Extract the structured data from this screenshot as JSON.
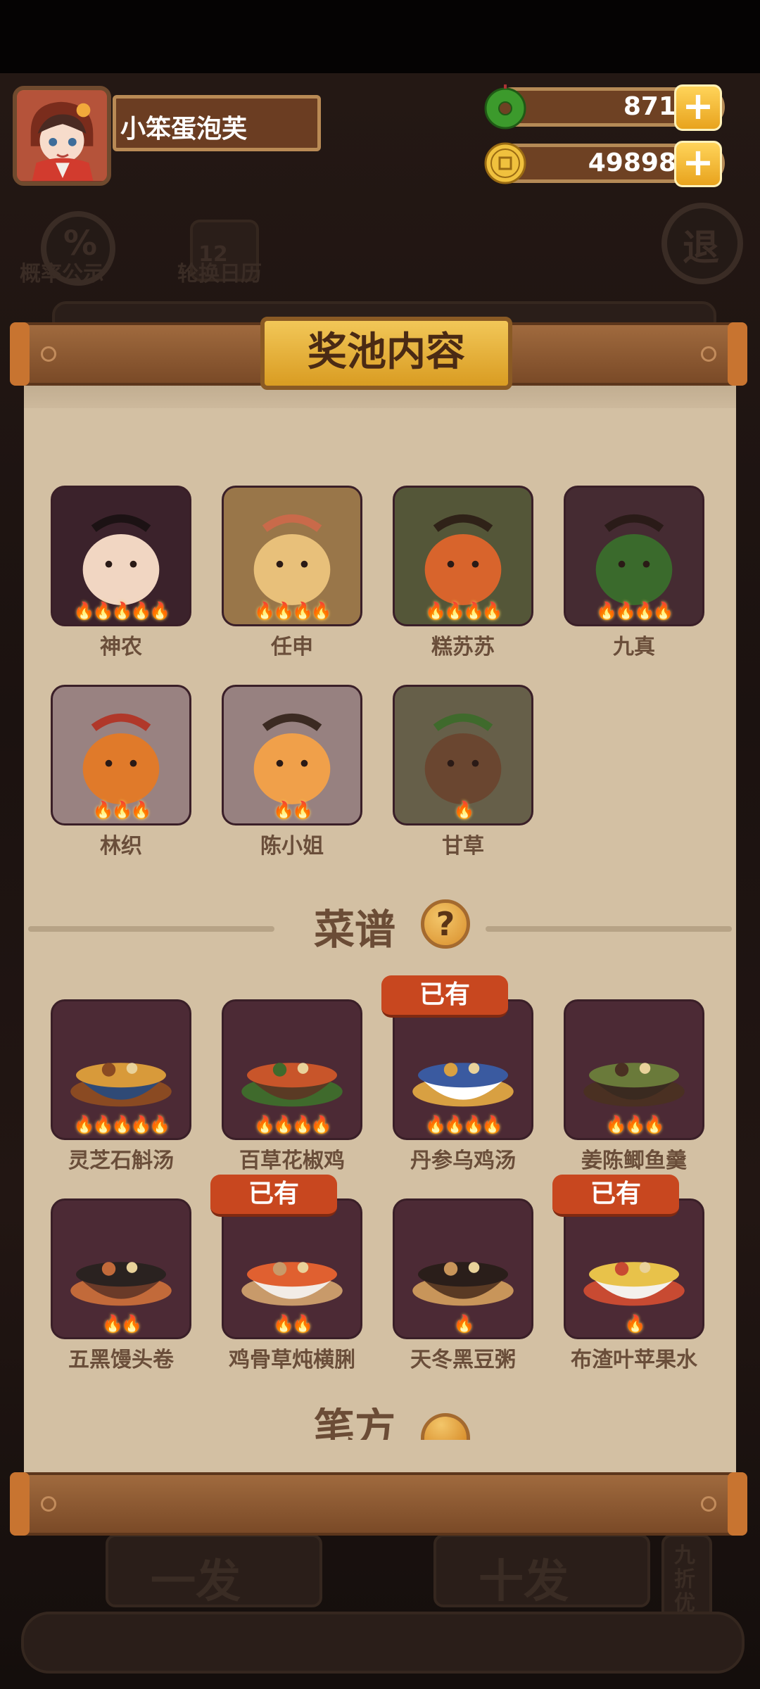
{
  "player": {
    "name": "小笨蛋泡芙"
  },
  "currency": {
    "jade": "871",
    "coins": "49898",
    "add_symbol": "+"
  },
  "background": {
    "probability_label": "概率公示",
    "probability_icon_text": "%",
    "calendar_label": "轮换日历",
    "calendar_icon_text": "12",
    "exit_label": "退",
    "draw_one_label": "一发",
    "draw_ten_label": "十发",
    "discount_label": "九折优惠"
  },
  "panel": {
    "title": "奖池内容",
    "owned_label": "已有",
    "help_symbol": "?",
    "characters": [
      {
        "name": "神农",
        "stars": 5
      },
      {
        "name": "任申",
        "stars": 4
      },
      {
        "name": "糕苏苏",
        "stars": 4
      },
      {
        "name": "九真",
        "stars": 4
      },
      {
        "name": "林织",
        "stars": 3
      },
      {
        "name": "陈小姐",
        "stars": 2
      },
      {
        "name": "甘草",
        "stars": 1
      }
    ],
    "recipes_section": {
      "title": "菜谱"
    },
    "recipes": [
      {
        "name": "灵芝石斛汤",
        "stars": 5,
        "owned": false
      },
      {
        "name": "百草花椒鸡",
        "stars": 4,
        "owned": false
      },
      {
        "name": "丹参乌鸡汤",
        "stars": 4,
        "owned": true
      },
      {
        "name": "姜陈鲫鱼羹",
        "stars": 3,
        "owned": false
      },
      {
        "name": "五黑馒头卷",
        "stars": 2,
        "owned": false
      },
      {
        "name": "鸡骨草炖横脷",
        "stars": 2,
        "owned": true
      },
      {
        "name": "天冬黑豆粥",
        "stars": 1,
        "owned": false
      },
      {
        "name": "布渣叶苹果水",
        "stars": 1,
        "owned": true
      }
    ],
    "next_section": {
      "title": "笔方"
    }
  },
  "colors": {
    "panel": "#d3c0a3",
    "tile": "#4c2a35",
    "owned_badge": "#c8471f",
    "title_badge": "#e9b43c"
  }
}
